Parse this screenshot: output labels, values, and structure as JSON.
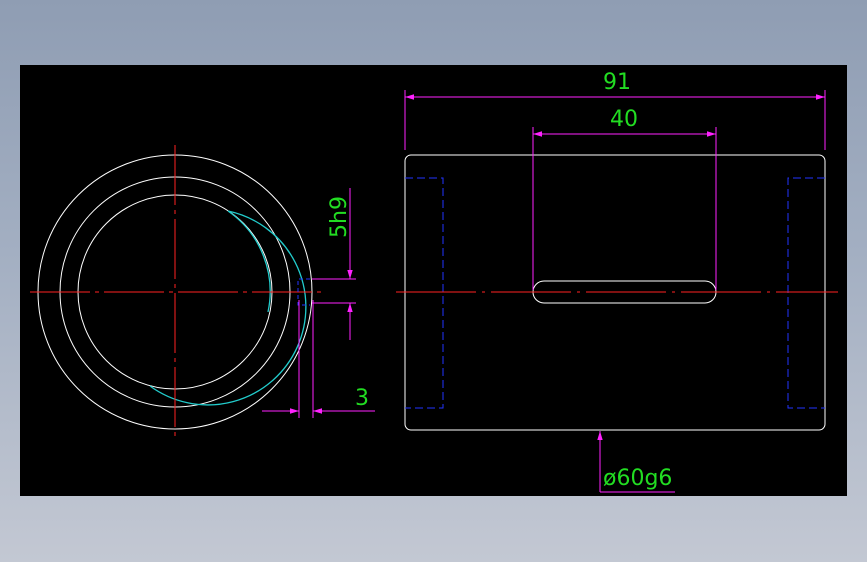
{
  "drawing": {
    "colors": {
      "background": "#000000",
      "outline": "#ffffff",
      "centerline": "#ff2222",
      "dimension": "#ff22ff",
      "dimension_text": "#22dd22",
      "hidden": "#2233ff",
      "cyan_arc": "#22cccc"
    },
    "dimensions": {
      "overall_length": "91",
      "keyway_length": "40",
      "keyway_width": "5h9",
      "keyway_depth": "3",
      "outer_diameter": "ø60g6"
    }
  }
}
